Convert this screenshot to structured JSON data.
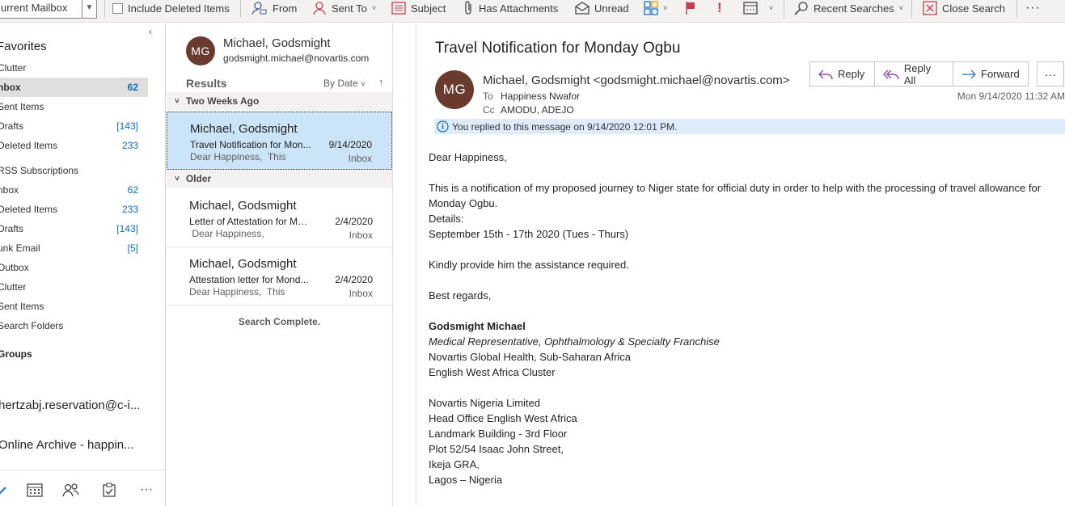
{
  "ribbon": {
    "scope": "urrent Mailbox",
    "include_deleted": "Include Deleted Items",
    "from": "From",
    "sent_to": "Sent To",
    "subject": "Subject",
    "has_attachments": "Has Attachments",
    "unread": "Unread",
    "recent_searches": "Recent Searches",
    "close_search": "Close Search"
  },
  "folders": {
    "favorites_header": "Favorites",
    "favorites": [
      {
        "label": "Clutter",
        "count": ""
      },
      {
        "label": "nbox",
        "count": "62"
      },
      {
        "label": "Sent Items",
        "count": ""
      },
      {
        "label": "Drafts",
        "count": "[143]"
      },
      {
        "label": "Deleted Items",
        "count": "233"
      }
    ],
    "mailbox": [
      {
        "label": "RSS Subscriptions",
        "count": ""
      },
      {
        "label": "nbox",
        "count": "62"
      },
      {
        "label": "Deleted Items",
        "count": "233"
      },
      {
        "label": "Drafts",
        "count": "[143]"
      },
      {
        "label": "unk Email",
        "count": "[5]"
      },
      {
        "label": "Outbox",
        "count": ""
      },
      {
        "label": "Clutter",
        "count": ""
      },
      {
        "label": "Sent Items",
        "count": ""
      },
      {
        "label": "Search Folders",
        "count": ""
      }
    ],
    "groups_header": "Groups",
    "accounts": [
      "hertzabj.reservation@c-i...",
      "Online Archive - happin..."
    ]
  },
  "list": {
    "person_initials": "MG",
    "person_name": "Michael, Godsmight",
    "person_email": "godsmight.michael@novartis.com",
    "results_label": "Results",
    "sort_label": "By Date",
    "groups": [
      "Two Weeks Ago",
      "Older"
    ],
    "messages": [
      {
        "from": "Michael, Godsmight",
        "subject": "Travel Notification for Mon...",
        "date": "9/14/2020",
        "preview": "Dear Happiness,  This",
        "folder": "Inbox"
      },
      {
        "from": "Michael, Godsmight",
        "subject": "Letter of Attestation for Mo...",
        "date": "2/4/2020",
        "preview": " Dear Happiness,",
        "folder": "Inbox"
      },
      {
        "from": "Michael, Godsmight",
        "subject": "Attestation letter for Mond...",
        "date": "2/4/2020",
        "preview": "Dear Happiness,  This",
        "folder": "Inbox"
      }
    ],
    "search_complete": "Search Complete."
  },
  "reading": {
    "title": "Travel Notification for Monday Ogbu",
    "actions": {
      "reply": "Reply",
      "reply_all": "Reply All",
      "forward": "Forward"
    },
    "sender_initials": "MG",
    "sender": "Michael, Godsmight <godsmight.michael@novartis.com>",
    "to_label": "To",
    "to": "Happiness Nwafor",
    "cc_label": "Cc",
    "cc": "AMODU, ADEJO",
    "date": "Mon 9/14/2020 11:32 AM",
    "info": "You replied to this message on 9/14/2020 12:01 PM.",
    "body": {
      "greeting": "Dear Happiness,",
      "para1": "This is a notification of my proposed journey to Niger state for official duty in order to help with the processing of travel allowance for Monday Ogbu.",
      "details_label": "Details:",
      "details": "September 15th - 17th 2020 (Tues - Thurs)",
      "request": "Kindly provide him the assistance required.",
      "closing": "Best regards,",
      "sig_name": "Godsmight Michael",
      "sig_title": "Medical Representative, Ophthalmology & Specialty Franchise",
      "sig_org1": "Novartis Global Health, Sub-Saharan Africa",
      "sig_org2": "English West Africa Cluster",
      "addr": [
        "Novartis Nigeria Limited",
        "Head Office English West Africa",
        "Landmark Building - 3rd Floor",
        "Plot 52/54 Isaac John Street,",
        "Ikeja GRA,",
        "Lagos – Nigeria"
      ]
    }
  },
  "colors": {
    "accent": "#0f6cbd",
    "avatar": "#6b3a2f",
    "selected": "#cce4f7"
  }
}
